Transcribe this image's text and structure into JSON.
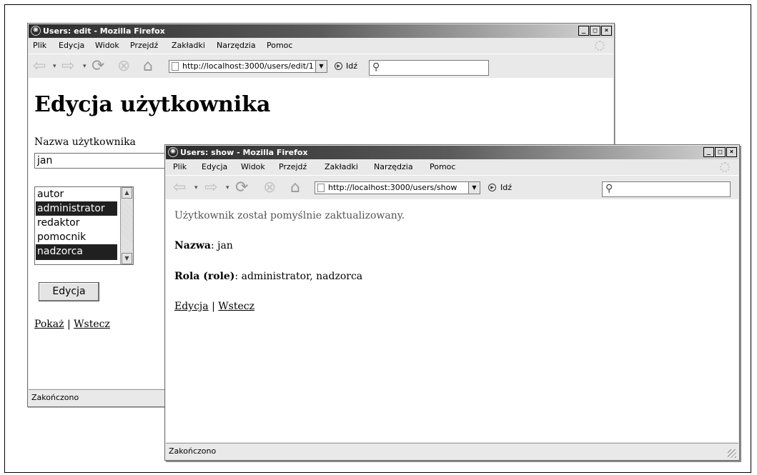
{
  "edit_window": {
    "title": "Users: edit - Mozilla Firefox",
    "menu": [
      {
        "label": "Plik"
      },
      {
        "label": "Edycja"
      },
      {
        "label": "Widok"
      },
      {
        "label": "Przejdź"
      },
      {
        "label": "Zakładki"
      },
      {
        "label": "Narzędzia"
      },
      {
        "label": "Pomoc"
      }
    ],
    "url": "http://localhost:3000/users/edit/1",
    "go_label": "Idź",
    "heading": "Edycja użytkownika",
    "username_label": "Nazwa użytkownika",
    "username_value": "jan",
    "roles": [
      {
        "label": "autor",
        "selected": false
      },
      {
        "label": "administrator",
        "selected": true
      },
      {
        "label": "redaktor",
        "selected": false
      },
      {
        "label": "pomocnik",
        "selected": false
      },
      {
        "label": "nadzorca",
        "selected": true
      }
    ],
    "submit_label": "Edycja",
    "link_show": "Pokaż",
    "link_separator": "|",
    "link_back": "Wstecz",
    "status": "Zakończono"
  },
  "show_window": {
    "title": "Users: show - Mozilla Firefox",
    "menu": [
      {
        "label": "Plik"
      },
      {
        "label": "Edycja"
      },
      {
        "label": "Widok"
      },
      {
        "label": "Przejdź"
      },
      {
        "label": "Zakładki"
      },
      {
        "label": "Narzędzia"
      },
      {
        "label": "Pomoc"
      }
    ],
    "url": "http://localhost:3000/users/show",
    "go_label": "Idź",
    "notice": "Użytkownik został pomyślnie zaktualizowany.",
    "name_label": "Nazwa",
    "name_value": ": jan",
    "role_label": "Rola (role)",
    "role_value": ": administrator, nadzorca",
    "link_edit": "Edycja",
    "link_separator": "|",
    "link_back": "Wstecz",
    "status": "Zakończono"
  },
  "icons": {
    "minimize": "minimize-icon",
    "maximize": "maximize-icon",
    "close": "close-icon"
  }
}
